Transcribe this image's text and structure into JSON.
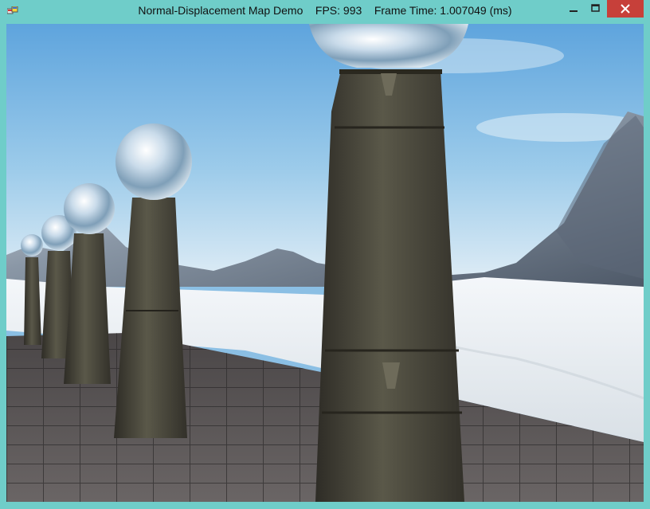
{
  "window": {
    "title": "Normal-Displacement Map Demo    FPS: 993    Frame Time: 1.007049 (ms)",
    "app_icon": "windows-app-icon",
    "frame_color": "#6fcdc9",
    "close_color": "#c7403a"
  },
  "controls": {
    "minimize_icon": "minimize-icon",
    "maximize_icon": "maximize-icon",
    "close_icon": "close-icon"
  },
  "scene": {
    "description_icons": [
      "sky",
      "snow-mountains",
      "tiled-floor",
      "stone-pillars",
      "chrome-spheres"
    ],
    "colors": {
      "sky_top": "#6eaee0",
      "sky_bottom": "#d6e9f4",
      "snow": "#eef2f5",
      "floor": "#5a5656",
      "stone": "#4d4a3e"
    }
  }
}
